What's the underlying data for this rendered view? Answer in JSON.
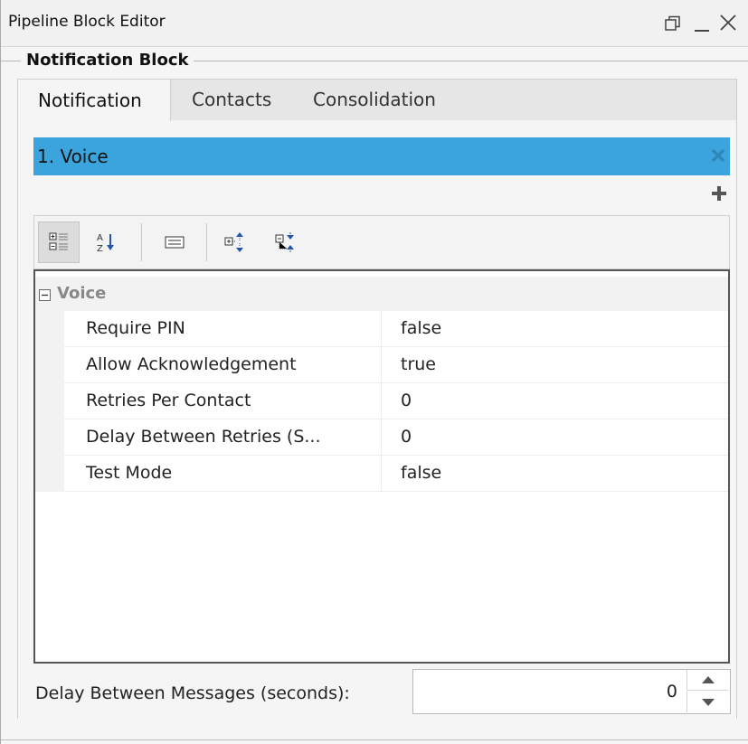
{
  "window": {
    "title": "Pipeline Block Editor",
    "controls": [
      "restore-icon",
      "minimize-icon",
      "close-icon"
    ]
  },
  "group": {
    "title": "Notification Block"
  },
  "tabs": [
    {
      "label": "Notification",
      "active": true
    },
    {
      "label": "Contacts",
      "active": false
    },
    {
      "label": "Consolidation",
      "active": false
    }
  ],
  "list": {
    "items": [
      {
        "label": "1.  Voice",
        "selected": true
      }
    ],
    "selected_color": "#3ba4dd"
  },
  "toolbar": {
    "buttons": [
      "categorized-view-icon",
      "alphabetical-sort-icon",
      "property-pages-icon",
      "expand-all-icon",
      "collapse-all-icon"
    ]
  },
  "property_grid": {
    "category": "Voice",
    "rows": [
      {
        "name": "Require PIN",
        "value": "false"
      },
      {
        "name": "Allow Acknowledgement",
        "value": "true"
      },
      {
        "name": "Retries Per Contact",
        "value": "0"
      },
      {
        "name": "Delay Between Retries (S...",
        "value": "0"
      },
      {
        "name": "Test Mode",
        "value": "false"
      }
    ]
  },
  "delay": {
    "label": "Delay Between Messages (seconds):",
    "value": "0"
  }
}
